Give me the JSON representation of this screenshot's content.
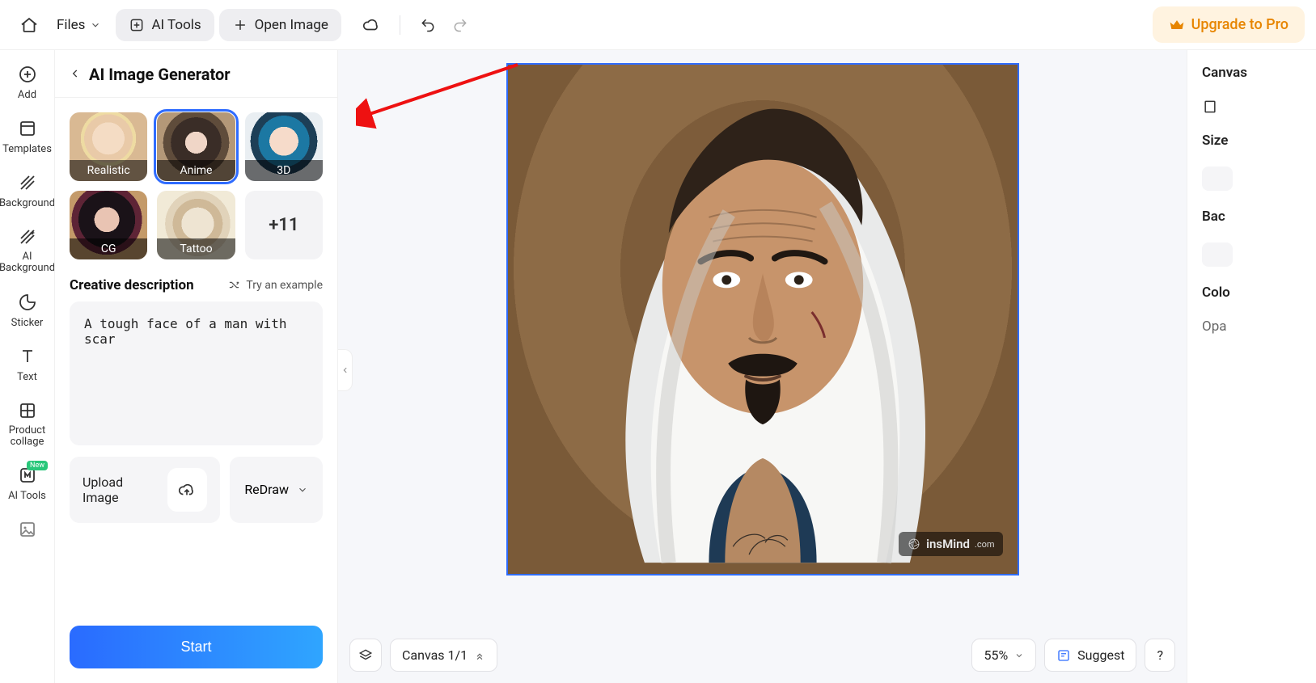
{
  "topbar": {
    "files": "Files",
    "ai_tools": "AI Tools",
    "open_image": "Open Image",
    "upgrade": "Upgrade to Pro"
  },
  "sidebar": {
    "items": [
      {
        "label": "Add"
      },
      {
        "label": "Templates"
      },
      {
        "label": "Background"
      },
      {
        "label": "AI Background"
      },
      {
        "label": "Sticker"
      },
      {
        "label": "Text"
      },
      {
        "label": "Product collage"
      },
      {
        "label": "AI Tools",
        "badge": "New"
      }
    ]
  },
  "panel": {
    "title": "AI Image Generator",
    "styles": [
      {
        "key": "realistic",
        "label": "Realistic",
        "selected": false
      },
      {
        "key": "anime",
        "label": "Anime",
        "selected": true
      },
      {
        "key": "threeD",
        "label": "3D",
        "selected": false
      },
      {
        "key": "cg",
        "label": "CG",
        "selected": false
      },
      {
        "key": "tattoo",
        "label": "Tattoo",
        "selected": false
      }
    ],
    "more_label": "+11",
    "desc_heading": "Creative description",
    "try_example": "Try an example",
    "description": "A tough face of a man with scar",
    "upload_label": "Upload Image",
    "redraw_label": "ReDraw",
    "start_label": "Start"
  },
  "canvas": {
    "indicator": "Canvas 1/1",
    "zoom": "55%",
    "suggest": "Suggest",
    "help": "?",
    "watermark_brand": "insMind",
    "watermark_domain": ".com"
  },
  "rightpanel": {
    "canvas": "Canvas",
    "size": "Size",
    "bac": "Bac",
    "color": "Colo",
    "opacity": "Opa"
  }
}
